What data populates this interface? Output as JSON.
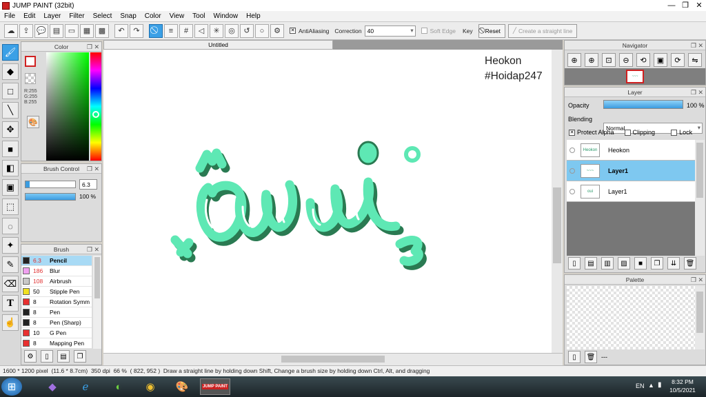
{
  "window": {
    "title": "JUMP PAINT (32bit)",
    "minimize": "—",
    "restore": "❐",
    "close": "✕"
  },
  "menu": [
    "File",
    "Edit",
    "Layer",
    "Filter",
    "Select",
    "Snap",
    "Color",
    "View",
    "Tool",
    "Window",
    "Help"
  ],
  "toolbar": {
    "antialiasing_label": "AntiAliasing",
    "correction_label": "Correction",
    "correction_value": "40",
    "soft_edge_label": "Soft Edge",
    "key_label": "Key",
    "reset_label": "Reset",
    "straight_line_label": "Create a straight line"
  },
  "color_panel": {
    "title": "Color",
    "r": "R:255",
    "g": "G:255",
    "b": "B:255"
  },
  "brush_control": {
    "title": "Brush Control",
    "size_value": "6.3",
    "opacity_value": "100 %"
  },
  "brush_panel": {
    "title": "Brush",
    "items": [
      {
        "size": "6.3",
        "name": "Pencil",
        "color": "#222222",
        "size_color": "#e03030"
      },
      {
        "size": "186",
        "name": "Blur",
        "color": "#f0a0f0",
        "size_color": "#e03030"
      },
      {
        "size": "108",
        "name": "Airbrush",
        "color": "#c8c8c8",
        "size_color": "#e03030"
      },
      {
        "size": "50",
        "name": "Stipple Pen",
        "color": "#f0e020",
        "size_color": "#000000"
      },
      {
        "size": "8",
        "name": "Rotation Symm",
        "color": "#e83030",
        "size_color": "#000000"
      },
      {
        "size": "8",
        "name": "Pen",
        "color": "#222222",
        "size_color": "#000000"
      },
      {
        "size": "8",
        "name": "Pen (Sharp)",
        "color": "#222222",
        "size_color": "#000000"
      },
      {
        "size": "10",
        "name": "G Pen",
        "color": "#e83030",
        "size_color": "#000000"
      },
      {
        "size": "8",
        "name": "Mapping Pen",
        "color": "#e83030",
        "size_color": "#000000"
      }
    ]
  },
  "canvas": {
    "tab_title": "Untitled",
    "watermark_line1": "Heokon",
    "watermark_line2": "#Hoidap247",
    "stroke_color": "#5ee8b4",
    "shadow_color": "#2a7a52"
  },
  "navigator": {
    "title": "Navigator"
  },
  "layer_panel": {
    "title": "Layer",
    "opacity_label": "Opacity",
    "opacity_value": "100 %",
    "blending_label": "Blending",
    "blending_value": "Normal",
    "protect_alpha_label": "Protect Alpha",
    "clipping_label": "Clipping",
    "lock_label": "Lock",
    "layers": [
      {
        "name": "Heokon",
        "selected": false,
        "thumb": "Heokon"
      },
      {
        "name": "Layer1",
        "selected": true,
        "thumb": "~~~"
      },
      {
        "name": "Layer1",
        "selected": false,
        "thumb": "oui"
      }
    ]
  },
  "palette_panel": {
    "title": "Palette",
    "extra": "---"
  },
  "statusbar": {
    "pixel_size": "1600 * 1200 pixel",
    "cm_size": "(11.6 * 8.7cm)",
    "dpi": "350 dpi",
    "zoom": "66 %",
    "coords": "( 822, 952 )",
    "hint": "Draw a straight line by holding down Shift, Change a brush size by holding down Ctrl, Alt, and dragging"
  },
  "taskbar": {
    "language": "EN",
    "time": "8:32 PM",
    "date": "10/5/2021",
    "app_label": "JUMP PAINT"
  }
}
